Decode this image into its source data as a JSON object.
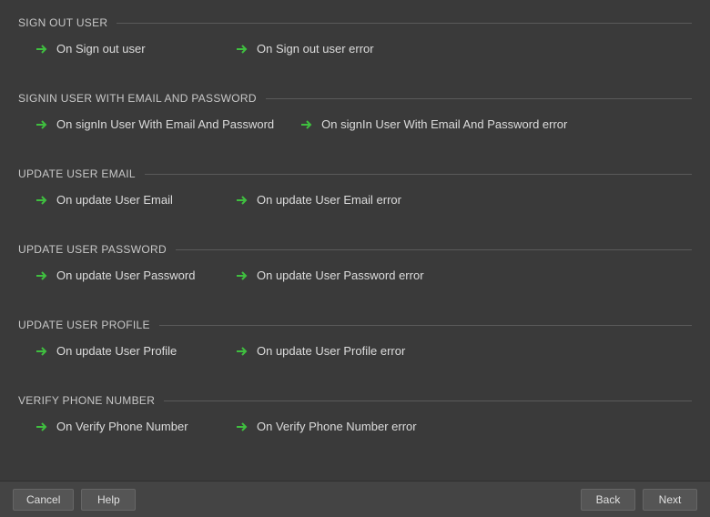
{
  "sections": [
    {
      "title": "SIGN OUT USER",
      "items": [
        {
          "label": "On Sign out user"
        },
        {
          "label": "On Sign out user error"
        }
      ]
    },
    {
      "title": "SIGNIN USER WITH EMAIL AND PASSWORD",
      "items": [
        {
          "label": "On signIn User With Email And Password"
        },
        {
          "label": "On signIn User With Email And Password error"
        }
      ]
    },
    {
      "title": "UPDATE USER EMAIL",
      "items": [
        {
          "label": "On update User Email"
        },
        {
          "label": "On update User Email error"
        }
      ]
    },
    {
      "title": "UPDATE USER PASSWORD",
      "items": [
        {
          "label": "On update User Password"
        },
        {
          "label": "On update User Password error"
        }
      ]
    },
    {
      "title": "UPDATE USER PROFILE",
      "items": [
        {
          "label": "On update User Profile"
        },
        {
          "label": "On update User Profile error"
        }
      ]
    },
    {
      "title": "VERIFY PHONE NUMBER",
      "items": [
        {
          "label": "On Verify Phone Number"
        },
        {
          "label": "On Verify Phone Number error"
        }
      ]
    }
  ],
  "footer": {
    "cancel": "Cancel",
    "help": "Help",
    "back": "Back",
    "next": "Next"
  }
}
